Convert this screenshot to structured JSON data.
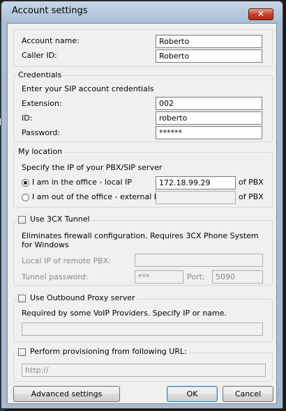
{
  "window": {
    "title": "Account settings",
    "close_glyph": "✕"
  },
  "account": {
    "name_label": "Account name:",
    "name_value": "Roberto",
    "callerid_label": "Caller ID:",
    "callerid_value": "Roberto"
  },
  "credentials": {
    "legend": "Credentials",
    "hint": "Enter your SIP account credentials",
    "extension_label": "Extension:",
    "extension_value": "002",
    "id_label": "ID:",
    "id_value": "roberto",
    "password_label": "Password:",
    "password_value": "******"
  },
  "location": {
    "legend": "My location",
    "hint": "Specify the IP of your PBX/SIP server",
    "in_office_label": "I am in the office - local IP",
    "in_office_value": "172.18.99.29",
    "in_office_suffix": "of PBX",
    "out_office_label": "I am out of the office - external IP",
    "out_office_value": "",
    "out_office_suffix": "of PBX",
    "selected": "in_office"
  },
  "tunnel": {
    "checkbox_label": "Use 3CX Tunnel",
    "checked": false,
    "desc": "Eliminates firewall configuration. Requires 3CX Phone System for Windows",
    "remote_ip_label": "Local IP of remote PBX:",
    "remote_ip_value": "",
    "password_label": "Tunnel password:",
    "password_value": "***",
    "port_label": "Port:",
    "port_value": "5090"
  },
  "proxy": {
    "checkbox_label": "Use Outbound Proxy server",
    "checked": false,
    "desc": "Required by some VoIP Providers. Specify IP or name.",
    "value": ""
  },
  "provisioning": {
    "checkbox_label": "Perform provisioning from following URL:",
    "checked": false,
    "url_value": "http://"
  },
  "buttons": {
    "advanced": "Advanced settings",
    "ok": "OK",
    "cancel": "Cancel"
  }
}
